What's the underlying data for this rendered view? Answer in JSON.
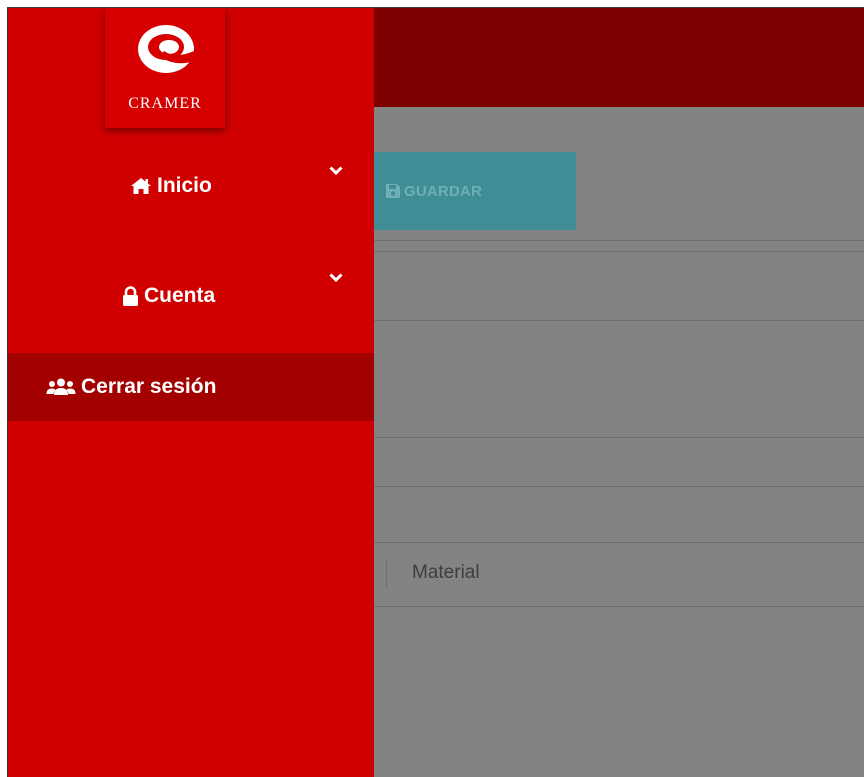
{
  "sidebar": {
    "brand": "CRAMER",
    "items": [
      {
        "label": "Inicio",
        "icon": "home-icon",
        "expandable": true
      },
      {
        "label": "Cuenta",
        "icon": "lock-icon",
        "expandable": true
      },
      {
        "label": "Cerrar sesión",
        "icon": "users-icon",
        "expandable": false,
        "highlighted": true
      }
    ]
  },
  "toolbar": {
    "save_label": "GUARDAR"
  },
  "form": {
    "material_placeholder": "Material"
  },
  "colors": {
    "sidebar": "#d10000",
    "sidebar_active": "#a30000",
    "topbar": "#7d0000",
    "overlay_bg": "#838383",
    "save_button": "#3f8d95"
  }
}
